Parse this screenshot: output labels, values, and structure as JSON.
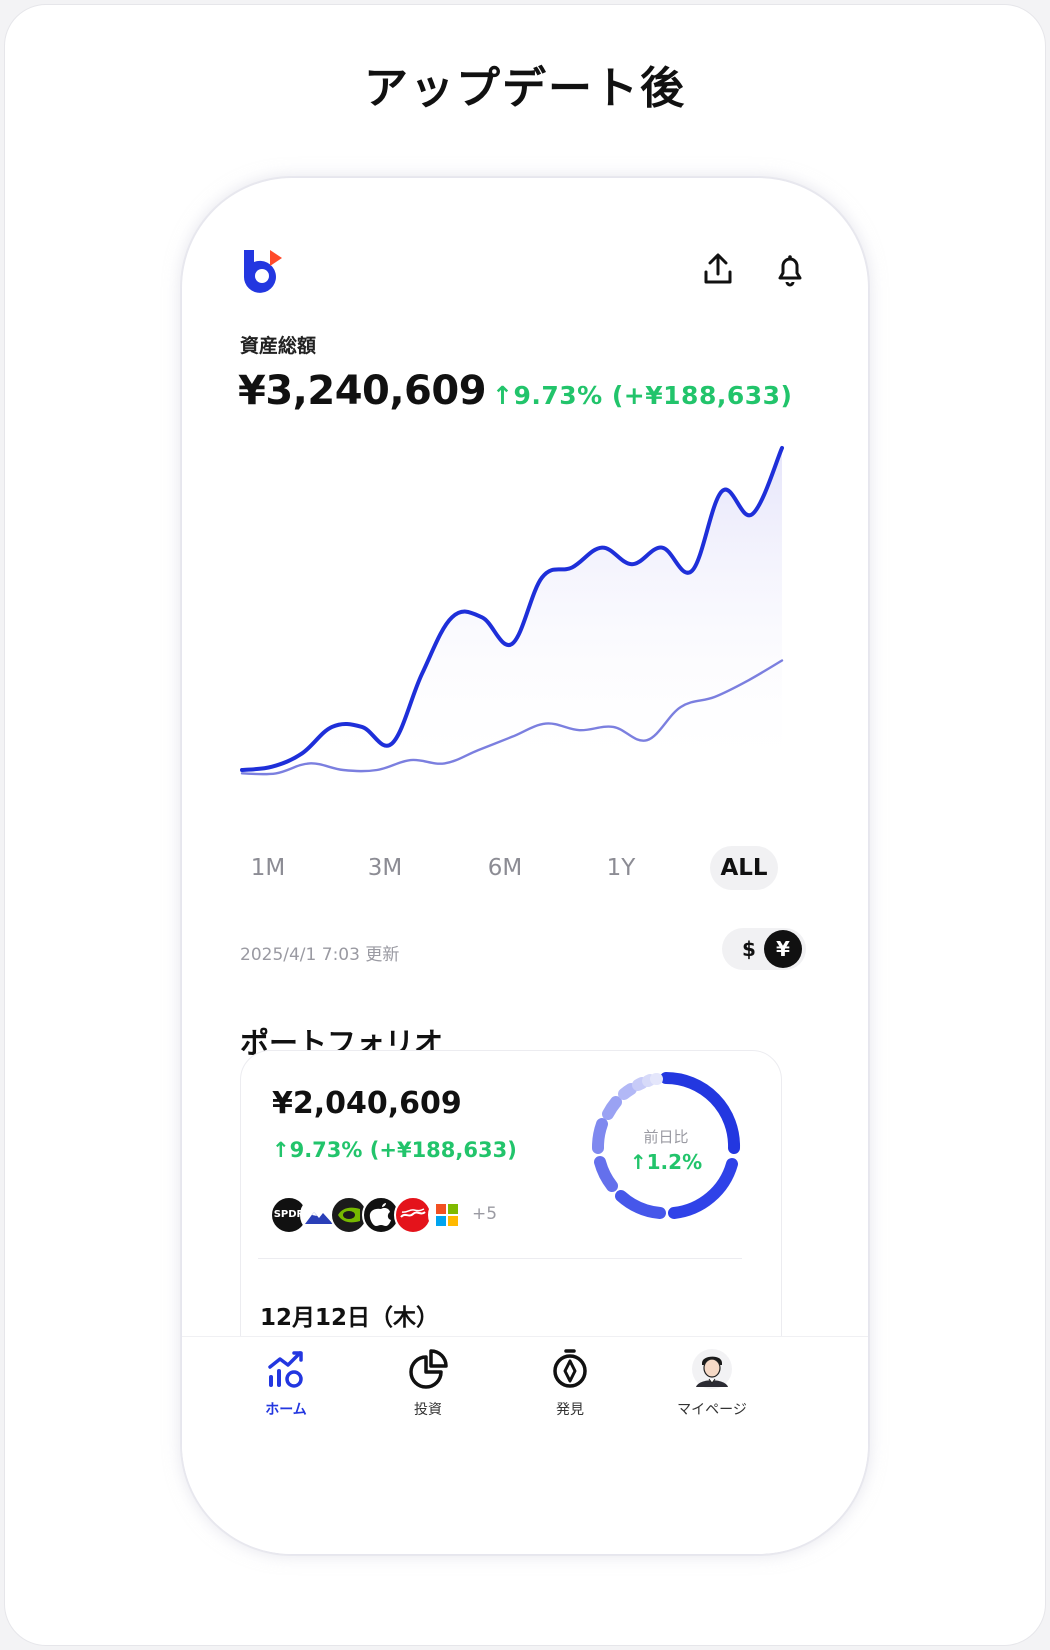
{
  "caption": "アップデート後",
  "header": {
    "logo_icon": "brand-logo",
    "upload_icon": "share-upload-icon",
    "bell_icon": "bell-icon"
  },
  "assets": {
    "label": "資産総額",
    "total": "¥3,240,609",
    "change": "↑9.73% (+¥188,633)"
  },
  "chart_data": {
    "type": "area",
    "title": "",
    "xlabel": "",
    "ylabel": "",
    "axes_visible": false,
    "grid": false,
    "series": [
      {
        "color": "#1e2fd9",
        "fill": "#e9e8fb",
        "values": [
          3,
          4,
          8,
          16,
          16,
          11,
          32,
          49,
          49,
          41,
          61,
          64,
          70,
          65,
          70,
          63,
          87,
          80,
          100
        ]
      },
      {
        "color": "#7b7fdf",
        "values": [
          2,
          2,
          5,
          3,
          3,
          6,
          5,
          9,
          13,
          17,
          15,
          16,
          12,
          22,
          25,
          30,
          36
        ]
      }
    ]
  },
  "ranges": {
    "items": [
      "1M",
      "3M",
      "6M",
      "1Y",
      "ALL"
    ],
    "selected": "ALL"
  },
  "updated": "2025/4/1 7:03 更新",
  "currency": {
    "usd": "$",
    "jpy": "¥",
    "selected": "¥"
  },
  "portfolio": {
    "title": "ポートフォリオ",
    "value": "¥2,040,609",
    "change": "↑9.73% (+¥188,633)",
    "holdings": [
      "SPDR",
      "mountain-logo",
      "nvidia-logo",
      "apple-logo",
      "coca-cola-logo",
      "microsoft-logo"
    ],
    "spdr_text": "SPDR",
    "more": "+5",
    "donut_label": "前日比",
    "donut_value": "↑1.2%",
    "date": "12月12日（木）"
  },
  "tabs": [
    {
      "label": "ホーム",
      "icon": "home-chart-icon",
      "active": true
    },
    {
      "label": "投資",
      "icon": "pie-chart-icon",
      "active": false
    },
    {
      "label": "発見",
      "icon": "compass-icon",
      "active": false
    },
    {
      "label": "マイページ",
      "icon": "avatar-icon",
      "active": false
    }
  ],
  "colors": {
    "accent": "#2337e0",
    "positive": "#22c46b",
    "text": "#111111",
    "muted": "#9a9aa2"
  }
}
